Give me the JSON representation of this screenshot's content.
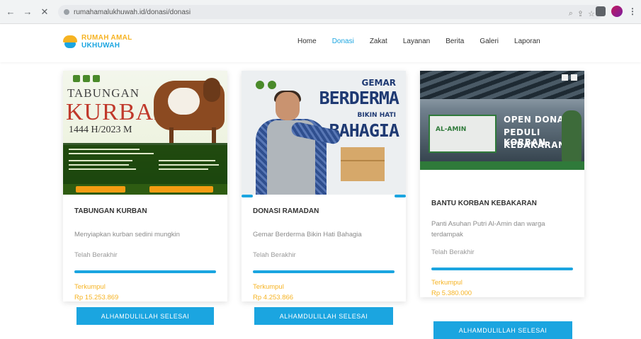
{
  "browser": {
    "url": "rumahamalukhuwah.id/donasi/donasi"
  },
  "header": {
    "logo_line1": "RUMAH AMAL",
    "logo_line2": "UKHUWAH",
    "nav": [
      "Home",
      "Donasi",
      "Zakat",
      "Layanan",
      "Berita",
      "Galeri",
      "Laporan"
    ],
    "active_nav": "Donasi"
  },
  "cards": [
    {
      "title": "TABUNGAN KURBAN",
      "description": "Menyiapkan kurban sedini mungkin",
      "status": "Telah Berakhir",
      "collected_label": "Terkumpul",
      "amount": "Rp 15.253.869",
      "button": "ALHAMDULILLAH SELESAI",
      "progress": 1.0,
      "image_text": {
        "lead": "TABUNGAN",
        "big": "KURBAN",
        "year": "1444 H/2023 M"
      }
    },
    {
      "title": "DONASI RAMADAN",
      "description": "Gemar Berderma Bikin Hati Bahagia",
      "status": "Telah Berakhir",
      "collected_label": "Terkumpul",
      "amount": "Rp 4.253.866",
      "button": "ALHAMDULILLAH SELESAI",
      "progress": 1.0,
      "image_text": {
        "gemar": "GEMAR",
        "berderma": "BERDERMA",
        "bikin": "BIKIN HATI",
        "bahagia": "BAHAGIA"
      }
    },
    {
      "title": "BANTU KORBAN KEBAKARAN",
      "description": "Panti Asuhan Putri Al-Amin dan warga terdampak",
      "status": "Telah Berakhir",
      "collected_label": "Terkumpul",
      "amount": "Rp 5.380.000",
      "button": "ALHAMDULILLAH SELESAI",
      "progress": 1.0,
      "image_text": {
        "sign": "AL-AMIN",
        "line1": "OPEN DONASI",
        "line2": "PEDULI KORBAN",
        "line3": "KEBAKARAN"
      }
    }
  ],
  "colors": {
    "accent": "#1ba5e0",
    "amount": "#f6b322",
    "brand_yellow": "#f6b322"
  }
}
